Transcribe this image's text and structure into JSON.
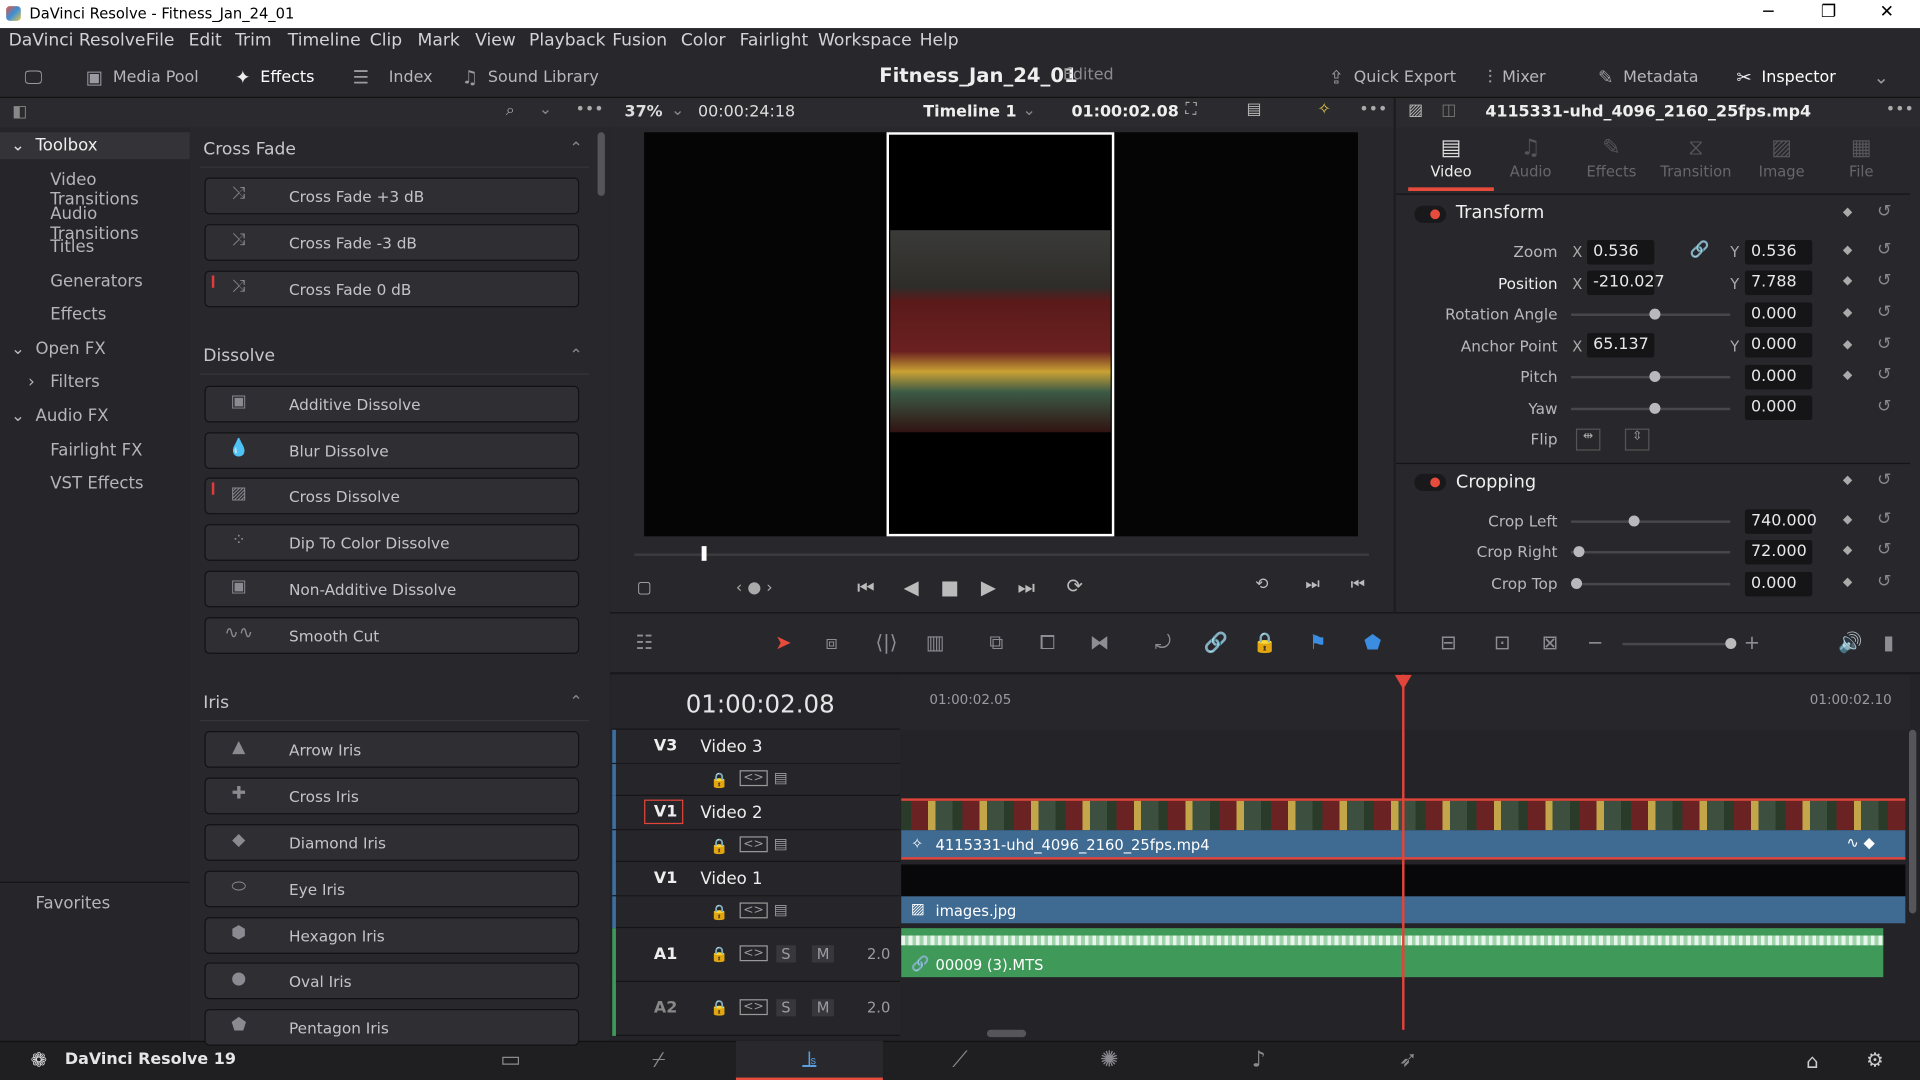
{
  "window": {
    "title": "DaVinci Resolve - Fitness_Jan_24_01",
    "minimize": "─",
    "maximize": "❐",
    "close": "✕"
  },
  "menu": [
    "DaVinci Resolve",
    "File",
    "Edit",
    "Trim",
    "Timeline",
    "Clip",
    "Mark",
    "View",
    "Playback",
    "Fusion",
    "Color",
    "Fairlight",
    "Workspace",
    "Help"
  ],
  "toolbar": {
    "media_pool": "Media Pool",
    "effects": "Effects",
    "index": "Index",
    "sound_library": "Sound Library",
    "project": "Fitness_Jan_24_01",
    "status": "Edited",
    "quick_export": "Quick Export",
    "mixer": "Mixer",
    "metadata": "Metadata",
    "inspector": "Inspector"
  },
  "viewer": {
    "zoom": "37%",
    "source_tc": "00:00:24:18",
    "timeline": "Timeline 1",
    "record_tc": "01:00:02.08",
    "clip_name": "4115331-uhd_4096_2160_25fps.mp4"
  },
  "sidebar": {
    "toolbox": "Toolbox",
    "items": [
      "Video Transitions",
      "Audio Transitions",
      "Titles",
      "Generators",
      "Effects"
    ],
    "open_fx": "Open FX",
    "filters": "Filters",
    "audio_fx": "Audio FX",
    "audio_items": [
      "Fairlight FX",
      "VST Effects"
    ],
    "favorites": "Favorites"
  },
  "effects": {
    "cross_fade": {
      "title": "Cross Fade",
      "items": [
        "Cross Fade +3 dB",
        "Cross Fade -3 dB",
        "Cross Fade 0 dB"
      ]
    },
    "dissolve": {
      "title": "Dissolve",
      "items": [
        "Additive Dissolve",
        "Blur Dissolve",
        "Cross Dissolve",
        "Dip To Color Dissolve",
        "Non-Additive Dissolve",
        "Smooth Cut"
      ]
    },
    "iris": {
      "title": "Iris",
      "items": [
        "Arrow Iris",
        "Cross Iris",
        "Diamond Iris",
        "Eye Iris",
        "Hexagon Iris",
        "Oval Iris",
        "Pentagon Iris"
      ]
    }
  },
  "inspector": {
    "tabs": [
      "Video",
      "Audio",
      "Effects",
      "Transition",
      "Image",
      "File"
    ],
    "transform": {
      "title": "Transform",
      "zoom_label": "Zoom",
      "zoom_x": "0.536",
      "zoom_y": "0.536",
      "position_label": "Position",
      "pos_x": "-210.027",
      "pos_y": "7.788",
      "rotation_label": "Rotation Angle",
      "rotation": "0.000",
      "anchor_label": "Anchor Point",
      "anchor_x": "65.137",
      "anchor_y": "0.000",
      "pitch_label": "Pitch",
      "pitch": "0.000",
      "yaw_label": "Yaw",
      "yaw": "0.000",
      "flip_label": "Flip",
      "x": "X",
      "y": "Y"
    },
    "cropping": {
      "title": "Cropping",
      "left_label": "Crop Left",
      "left": "740.000",
      "right_label": "Crop Right",
      "right": "72.000",
      "top_label": "Crop Top",
      "top": "0.000"
    }
  },
  "timeline": {
    "timecode": "01:00:02.08",
    "ruler": [
      "01:00:02.05",
      "01:00:02.10"
    ],
    "tracks": [
      {
        "id": "V3",
        "name": "Video 3"
      },
      {
        "id": "V1",
        "name": "Video 2"
      },
      {
        "id": "V1",
        "name": "Video 1"
      }
    ],
    "audio": [
      {
        "id": "A1",
        "s": "S",
        "m": "M",
        "level": "2.0"
      },
      {
        "id": "A2",
        "s": "S",
        "m": "M",
        "level": "2.0"
      }
    ],
    "clips": {
      "v2": "4115331-uhd_4096_2160_25fps.mp4",
      "v1": "images.jpg",
      "a1": "00009 (3).MTS"
    }
  },
  "footer": {
    "app": "DaVinci Resolve 19"
  },
  "colors": {
    "accent": "#e64b3c",
    "clip_video": "#3f6a92",
    "clip_audio": "#3f9a5a",
    "playhead": "#e0443a"
  }
}
